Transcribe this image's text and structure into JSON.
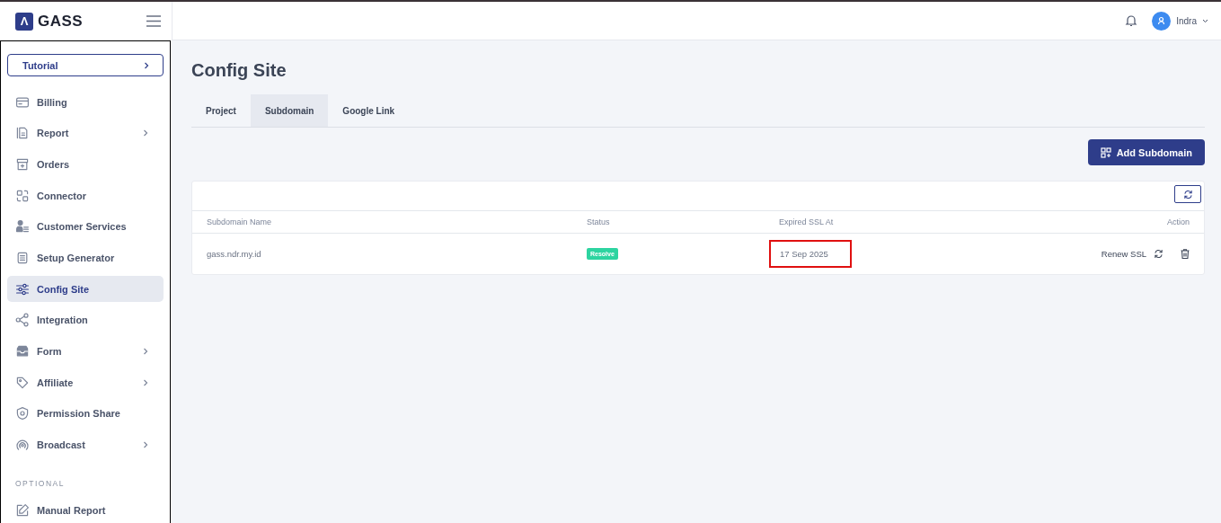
{
  "brand": {
    "name": "GASS",
    "logo_letter": "Λ"
  },
  "topbar": {
    "user": "Indra"
  },
  "sidebar": {
    "tutorial": "Tutorial",
    "items": [
      {
        "label": "Billing",
        "has_submenu": false,
        "selected": false
      },
      {
        "label": "Report",
        "has_submenu": true,
        "selected": false
      },
      {
        "label": "Orders",
        "has_submenu": false,
        "selected": false
      },
      {
        "label": "Connector",
        "has_submenu": false,
        "selected": false
      },
      {
        "label": "Customer Services",
        "has_submenu": false,
        "selected": false
      },
      {
        "label": "Setup Generator",
        "has_submenu": false,
        "selected": false
      },
      {
        "label": "Config Site",
        "has_submenu": false,
        "selected": true
      },
      {
        "label": "Integration",
        "has_submenu": false,
        "selected": false
      },
      {
        "label": "Form",
        "has_submenu": true,
        "selected": false
      },
      {
        "label": "Affiliate",
        "has_submenu": true,
        "selected": false
      },
      {
        "label": "Permission Share",
        "has_submenu": false,
        "selected": false
      },
      {
        "label": "Broadcast",
        "has_submenu": true,
        "selected": false
      }
    ],
    "section": "OPTIONAL",
    "optional_items": [
      {
        "label": "Manual Report",
        "has_submenu": false,
        "selected": false
      }
    ]
  },
  "page": {
    "title": "Config Site",
    "tabs": [
      {
        "label": "Project",
        "selected": false
      },
      {
        "label": "Subdomain",
        "selected": true
      },
      {
        "label": "Google Link",
        "selected": false
      }
    ],
    "add_button": "Add Subdomain",
    "table": {
      "columns": [
        "Subdomain Name",
        "Status",
        "Expired SSL At",
        "Action"
      ],
      "rows": [
        {
          "name": "gass.ndr.my.id",
          "status": "Resolve",
          "expired": "17 Sep 2025",
          "expired_highlighted": true,
          "renew": "Renew SSL"
        }
      ]
    }
  }
}
